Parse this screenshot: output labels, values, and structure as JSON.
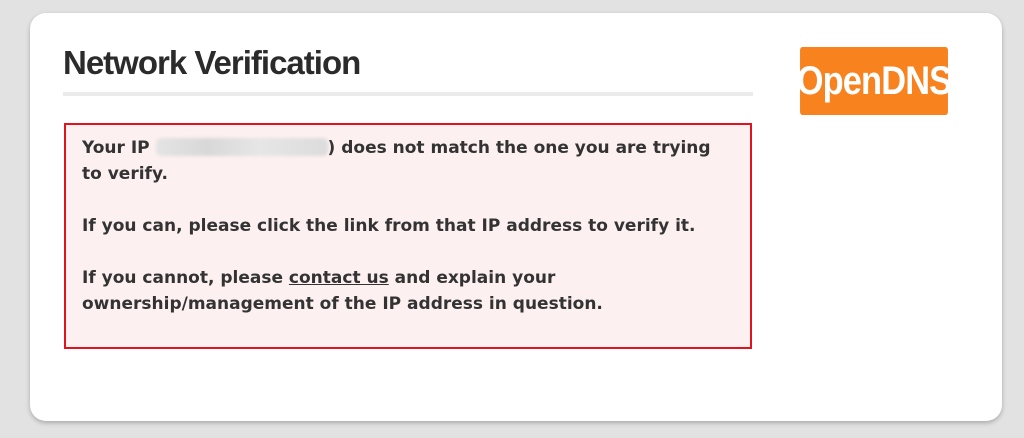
{
  "page": {
    "title": "Network Verification",
    "logo_text": "OpenDNS"
  },
  "message": {
    "p1_before": "Your IP ",
    "ip_value": "",
    "p1_after": ") does not match the one you are trying to verify.",
    "p2": "If you can, please click the link from that IP address to verify it.",
    "p3_before": "If you cannot, please ",
    "contact_link": "contact us",
    "p3_after": " and explain your ownership/management of the IP address in question."
  },
  "colors": {
    "brand_orange": "#f7821e",
    "error_border": "#e0141e",
    "error_background": "#fdf0f0"
  }
}
